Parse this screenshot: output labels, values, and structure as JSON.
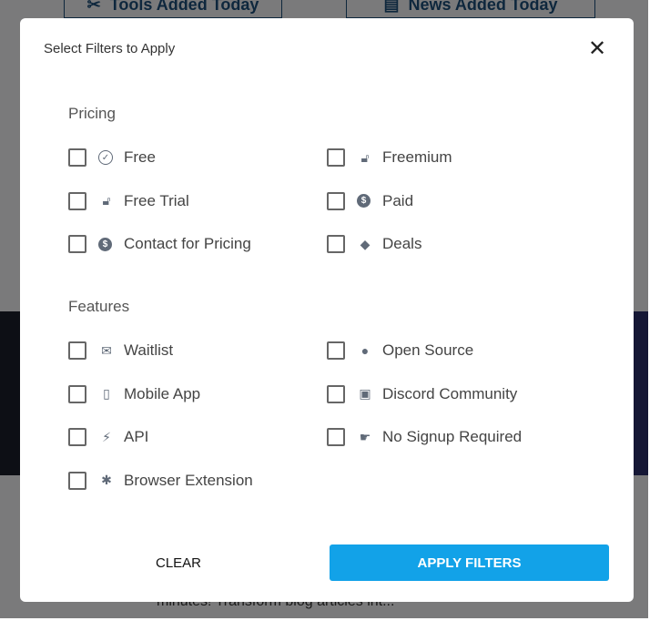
{
  "background": {
    "tabs": [
      "Tools Added Today",
      "News Added Today"
    ],
    "snippet": "minutes! Transform blog articles int..."
  },
  "modal": {
    "title": "Select Filters to Apply",
    "close_icon": "close-icon",
    "sections": [
      {
        "title": "Pricing",
        "options": [
          {
            "label": "Free",
            "icon": "check-circle-icon",
            "checked": false
          },
          {
            "label": "Freemium",
            "icon": "lock-open-icon",
            "checked": false
          },
          {
            "label": "Free Trial",
            "icon": "lock-open-icon",
            "checked": false
          },
          {
            "label": "Paid",
            "icon": "dollar-circle-icon",
            "checked": false
          },
          {
            "label": "Contact for Pricing",
            "icon": "dollar-circle-icon",
            "checked": false
          },
          {
            "label": "Deals",
            "icon": "tag-icon",
            "checked": false
          }
        ]
      },
      {
        "title": "Features",
        "options": [
          {
            "label": "Waitlist",
            "icon": "envelope-icon",
            "checked": false
          },
          {
            "label": "Open Source",
            "icon": "github-icon",
            "checked": false
          },
          {
            "label": "Mobile App",
            "icon": "mobile-icon",
            "checked": false
          },
          {
            "label": "Discord Community",
            "icon": "discord-icon",
            "checked": false
          },
          {
            "label": "API",
            "icon": "plug-icon",
            "checked": false
          },
          {
            "label": "No Signup Required",
            "icon": "hand-point-icon",
            "checked": false
          },
          {
            "label": "Browser Extension",
            "icon": "puzzle-icon",
            "checked": false
          }
        ]
      }
    ],
    "clear_label": "CLEAR",
    "apply_label": "APPLY FILTERS",
    "accent": "#12a2e8"
  }
}
